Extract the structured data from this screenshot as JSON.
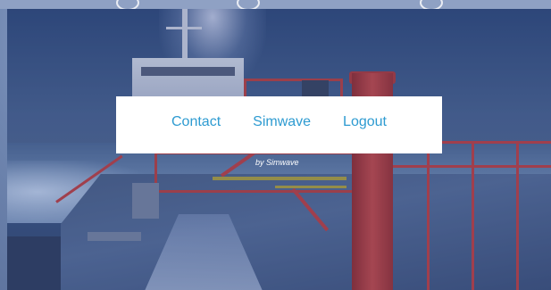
{
  "nav": {
    "items": [
      {
        "label": "Contact"
      },
      {
        "label": "Simwave"
      },
      {
        "label": "Logout"
      }
    ]
  },
  "byline": "by Simwave",
  "colors": {
    "link": "#2e9bd1",
    "nav_background": "#ffffff",
    "byline": "#ffffff",
    "background_tint": "#4b5f8a"
  },
  "background_image": {
    "subject_icon": "ship-deck-photo-icon"
  }
}
